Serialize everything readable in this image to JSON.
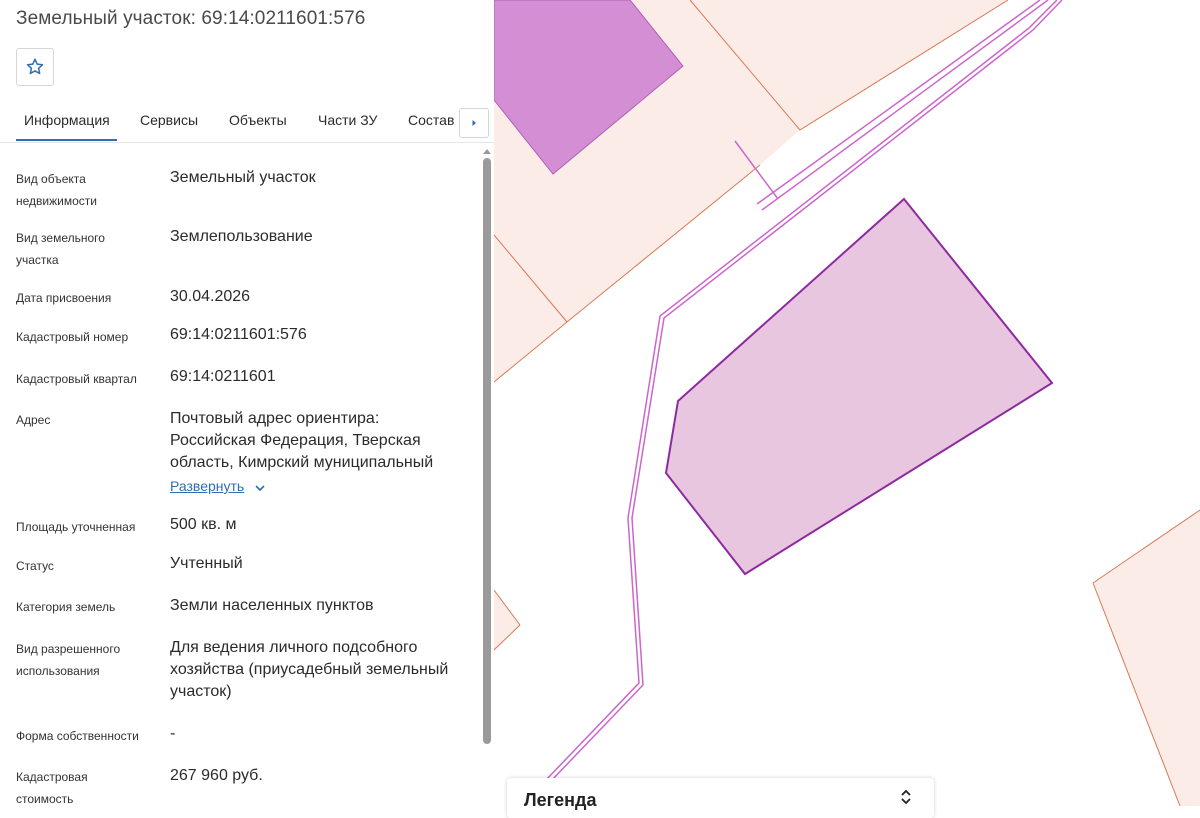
{
  "panel": {
    "title": "Земельный участок: 69:14:0211601:576"
  },
  "favorite": {
    "icon": "star-outline-icon"
  },
  "tabs": [
    {
      "label": "Информация",
      "active": true
    },
    {
      "label": "Сервисы",
      "active": false
    },
    {
      "label": "Объекты",
      "active": false
    },
    {
      "label": "Части ЗУ",
      "active": false
    },
    {
      "label": "Состав",
      "active": false
    }
  ],
  "tab_scroll": {
    "icon": "chevron-right-icon"
  },
  "fields": {
    "object_type": {
      "label_l1": "Вид объекта",
      "label_l2": "недвижимости",
      "value": "Земельный участок"
    },
    "land_type": {
      "label_l1": "Вид земельного",
      "label_l2": "участка",
      "value": "Землепользование"
    },
    "assign_date": {
      "label": "Дата присвоения",
      "value": "30.04.2026"
    },
    "cadastral_number": {
      "label": "Кадастровый номер",
      "value": "69:14:0211601:576"
    },
    "cadastral_quarter": {
      "label": "Кадастровый квартал",
      "value": "69:14:0211601"
    },
    "address": {
      "label": "Адрес",
      "value_l1": "Почтовый адрес ориентира:",
      "value_l2": "Российская Федерация, Тверская",
      "value_l3": "область, Кимрский муниципальный",
      "expand_label": "Развернуть"
    },
    "area": {
      "label": "Площадь уточненная",
      "value": "500 кв. м"
    },
    "status": {
      "label": "Статус",
      "value": "Учтенный"
    },
    "land_category": {
      "label": "Категория земель",
      "value": "Земли населенных пунктов"
    },
    "permitted_use": {
      "label_l1": "Вид разрешенного",
      "label_l2": "использования",
      "value_l1": "Для ведения личного подсобного",
      "value_l2": "хозяйства (приусадебный земельный",
      "value_l3": "участок)"
    },
    "ownership": {
      "label": "Форма собственности",
      "value": "-"
    },
    "cadastral_value": {
      "label_l1": "Кадастровая",
      "label_l2": "стоимость",
      "value": "267 960 руб."
    }
  },
  "legend": {
    "title": "Легенда",
    "toggle_icon": "chevron-up-down-icon"
  },
  "colors": {
    "accent": "#2f6db5",
    "selected_parcel_fill": "#e8c6e0",
    "selected_parcel_stroke": "#8e2aa0",
    "neighbor_parcel_fill": "#d48fd4",
    "land_fill": "#fbece8",
    "boundary_line": "#d77a55",
    "road_line": "#cc66cc"
  }
}
